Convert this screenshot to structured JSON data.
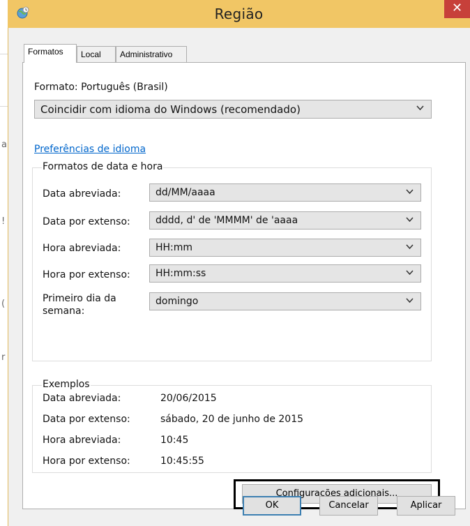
{
  "window": {
    "title": "Região",
    "close_glyph": "✕"
  },
  "tabs": [
    {
      "label": "Formatos",
      "active": true
    },
    {
      "label": "Local",
      "active": false
    },
    {
      "label": "Administrativo",
      "active": false
    }
  ],
  "formats": {
    "format_label": "Formato: Português (Brasil)",
    "format_value": "Coincidir com idioma do Windows (recomendado)",
    "language_prefs_link": "Preferências de idioma",
    "group_title": "Formatos de data e hora",
    "fields": [
      {
        "label": "Data abreviada:",
        "value": "dd/MM/aaaa"
      },
      {
        "label": "Data por extenso:",
        "value": "dddd, d' de 'MMMM' de 'aaaa"
      },
      {
        "label": "Hora abreviada:",
        "value": "HH:mm"
      },
      {
        "label": "Hora por extenso:",
        "value": "HH:mm:ss"
      },
      {
        "label_line1": "Primeiro dia da",
        "label_line2": "semana:",
        "value": "domingo"
      }
    ]
  },
  "examples": {
    "title": "Exemplos",
    "rows": [
      {
        "label": "Data abreviada:",
        "value": "20/06/2015"
      },
      {
        "label": "Data por extenso:",
        "value": "sábado, 20 de junho de 2015"
      },
      {
        "label": "Hora abreviada:",
        "value": "10:45"
      },
      {
        "label": "Hora por extenso:",
        "value": "10:45:55"
      }
    ]
  },
  "buttons": {
    "additional": "Configurações adicionais...",
    "ok": "OK",
    "cancel": "Cancelar",
    "apply": "Aplicar"
  },
  "icons": {
    "title_icon": "globe-clock-icon",
    "chevron": "chevron-down-icon",
    "close": "close-icon"
  },
  "colors": {
    "titlebar": "#f1c665",
    "close": "#c7403a",
    "link": "#0066cc",
    "highlight": "#000000"
  }
}
